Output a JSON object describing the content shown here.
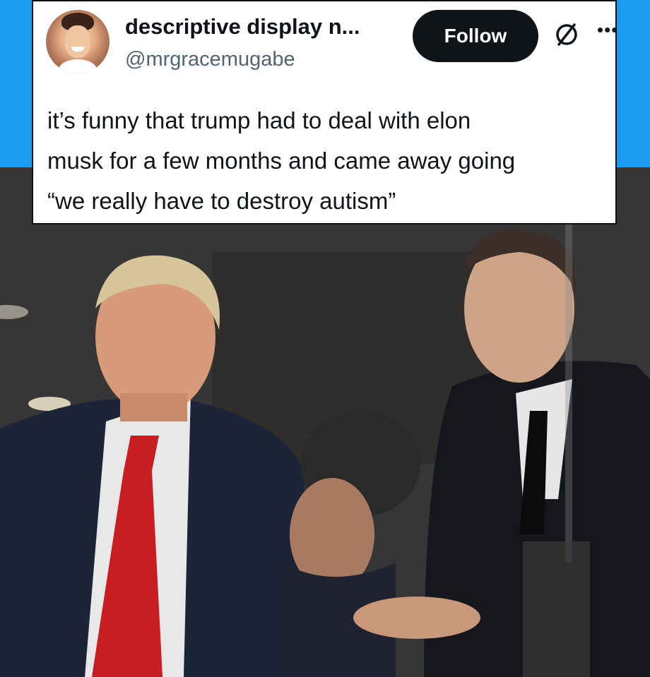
{
  "tweet": {
    "display_name": "descriptive display n...",
    "handle": "@mrgracemugabe",
    "follow_label": "Follow",
    "text": "it’s funny that trump had to deal with elon\nmusk for a few months and came away going\n“we really have to destroy autism”"
  },
  "icons": {
    "verified_alt": "slashed-circle-icon",
    "more": "more-options-icon"
  },
  "colors": {
    "band": "#1d9bf0",
    "follow_bg": "#0f1419",
    "handle": "#536471"
  }
}
